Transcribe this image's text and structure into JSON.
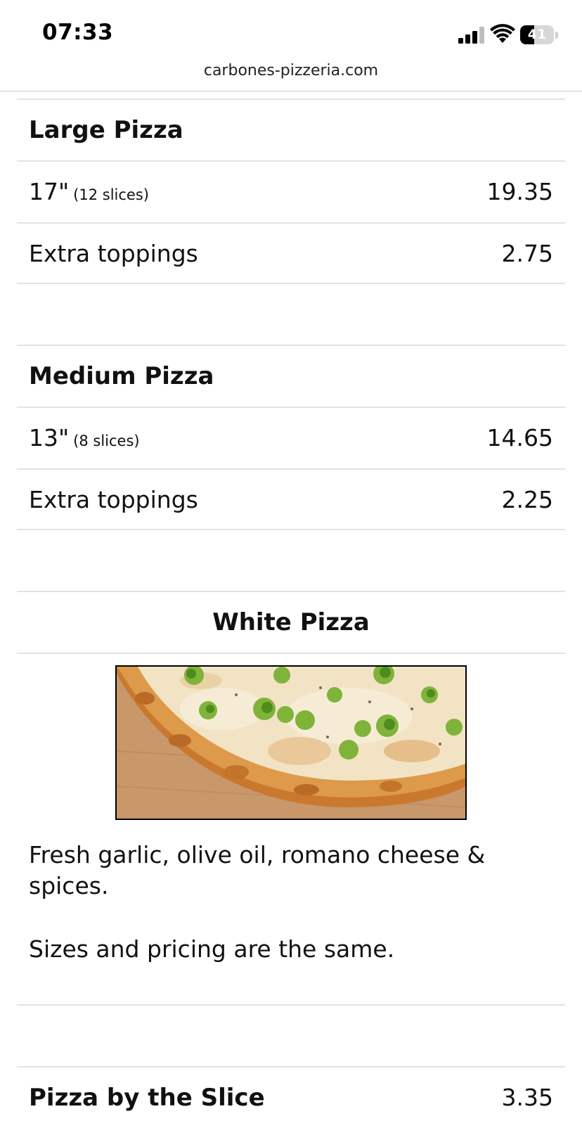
{
  "status_bar": {
    "time": "07:33",
    "battery": "41",
    "battery_level_percent": 41,
    "icons": [
      "cellular-signal-icon",
      "wifi-icon",
      "battery-icon"
    ]
  },
  "browser": {
    "url": "carbones-pizzeria.com"
  },
  "menu": {
    "large_pizza": {
      "title": "Large Pizza",
      "size_label": "17\"",
      "size_note": "(12 slices)",
      "size_price": "19.35",
      "toppings_label": "Extra toppings",
      "toppings_price": "2.75"
    },
    "medium_pizza": {
      "title": "Medium Pizza",
      "size_label": "13\"",
      "size_note": "(8 slices)",
      "size_price": "14.65",
      "toppings_label": "Extra toppings",
      "toppings_price": "2.25"
    },
    "white_pizza": {
      "title": "White Pizza",
      "description": "Fresh garlic, olive oil, romano cheese & spices.",
      "note": "Sizes and pricing are the same."
    },
    "slice": {
      "title": "Pizza by the Slice",
      "price": "3.35"
    }
  },
  "colors": {
    "divider": "#e3e3e3",
    "text": "#111111",
    "background": "#ffffff"
  }
}
